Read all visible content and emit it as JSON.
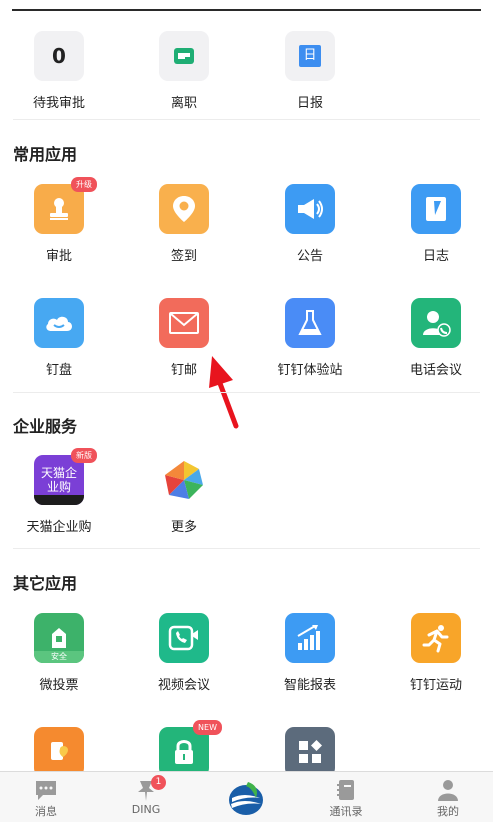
{
  "quick_actions": [
    {
      "label": "待我审批",
      "value": "0"
    },
    {
      "label": "离职",
      "icon": "resign-icon"
    },
    {
      "label": "日报",
      "icon": "daily-report-icon",
      "icon_text": "日"
    }
  ],
  "sections": {
    "common": {
      "title": "常用应用",
      "apps": [
        {
          "label": "审批",
          "icon": "approval-stamp-icon",
          "color": "#f8ac4a",
          "badge": "升级"
        },
        {
          "label": "签到",
          "icon": "location-pin-icon",
          "color": "#f9b04d"
        },
        {
          "label": "公告",
          "icon": "megaphone-icon",
          "color": "#3d9bf3"
        },
        {
          "label": "日志",
          "icon": "notebook-icon",
          "color": "#3d9bf3"
        },
        {
          "label": "钉盘",
          "icon": "cloud-icon",
          "color": "#47a8f2"
        },
        {
          "label": "钉邮",
          "icon": "mail-icon",
          "color": "#f26b5b"
        },
        {
          "label": "钉钉体验站",
          "icon": "flask-icon",
          "color": "#4a8cf6"
        },
        {
          "label": "电话会议",
          "icon": "phone-conference-icon",
          "color": "#23b57a"
        }
      ]
    },
    "enterprise": {
      "title": "企业服务",
      "apps": [
        {
          "label": "天猫企业购",
          "icon": "tmall-icon",
          "color": "#7b3fd6",
          "badge": "新版",
          "icon_text": "天猫企业购"
        },
        {
          "label": "更多",
          "icon": "more-pinwheel-icon"
        }
      ]
    },
    "other": {
      "title": "其它应用",
      "apps": [
        {
          "label": "微投票",
          "icon": "vote-icon",
          "color": "#3db26a",
          "icon_text": "安全"
        },
        {
          "label": "视频会议",
          "icon": "video-call-icon",
          "color": "#1fb98a"
        },
        {
          "label": "智能报表",
          "icon": "chart-report-icon",
          "color": "#3d9bf3"
        },
        {
          "label": "钉钉运动",
          "icon": "running-icon",
          "color": "#f8a529"
        },
        {
          "label": "",
          "icon": "app-orange-icon",
          "color": "#f58a2f"
        },
        {
          "label": "",
          "icon": "lock-icon",
          "color": "#23b57a",
          "badge": "NEW"
        },
        {
          "label": "",
          "icon": "grid-apps-icon",
          "color": "#5c6b7c"
        }
      ]
    }
  },
  "tabbar": [
    {
      "label": "消息",
      "icon": "message-icon"
    },
    {
      "label": "DING",
      "icon": "ding-pin-icon",
      "badge": "1"
    },
    {
      "label": "",
      "icon": "dingtalk-logo-icon"
    },
    {
      "label": "通讯录",
      "icon": "contacts-icon"
    },
    {
      "label": "我的",
      "icon": "profile-icon"
    }
  ]
}
